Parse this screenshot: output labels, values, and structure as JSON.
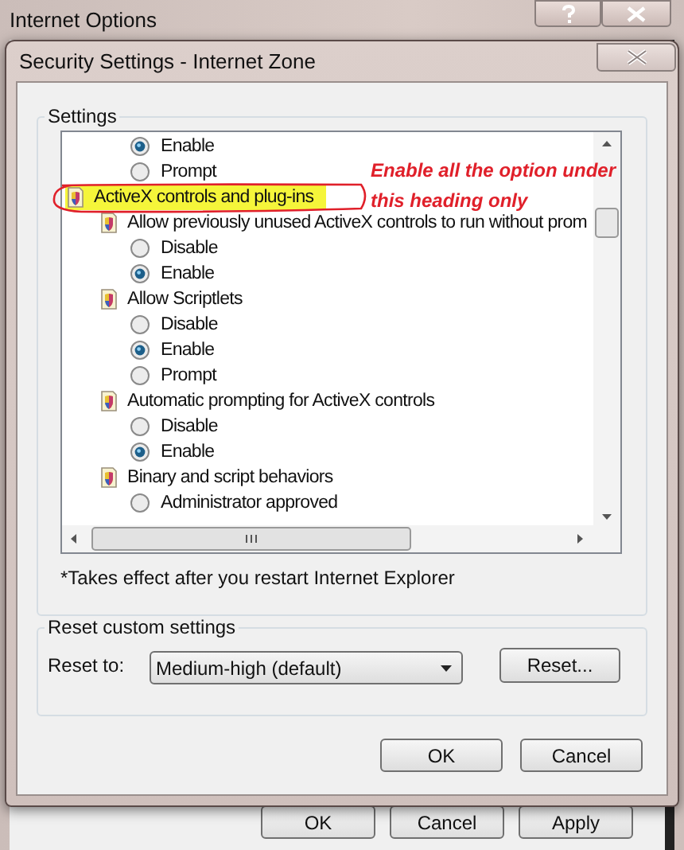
{
  "outer_window": {
    "title": "Internet Options",
    "buttons": [
      "OK",
      "Cancel",
      "Apply"
    ]
  },
  "dialog": {
    "title": "Security Settings - Internet Zone",
    "settings": {
      "label": "Settings",
      "items": [
        {
          "kind": "option",
          "label": "Enable",
          "selected": true
        },
        {
          "kind": "option",
          "label": "Prompt",
          "selected": false
        },
        {
          "kind": "category",
          "label": "ActiveX controls and plug-ins",
          "highlighted": true,
          "children": [
            {
              "kind": "setting",
              "label": "Allow previously unused ActiveX controls to run without prom",
              "children": [
                {
                  "kind": "option",
                  "label": "Disable",
                  "selected": false
                },
                {
                  "kind": "option",
                  "label": "Enable",
                  "selected": true
                }
              ]
            },
            {
              "kind": "setting",
              "label": "Allow Scriptlets",
              "children": [
                {
                  "kind": "option",
                  "label": "Disable",
                  "selected": false
                },
                {
                  "kind": "option",
                  "label": "Enable",
                  "selected": true
                },
                {
                  "kind": "option",
                  "label": "Prompt",
                  "selected": false
                }
              ]
            },
            {
              "kind": "setting",
              "label": "Automatic prompting for ActiveX controls",
              "children": [
                {
                  "kind": "option",
                  "label": "Disable",
                  "selected": false
                },
                {
                  "kind": "option",
                  "label": "Enable",
                  "selected": true
                }
              ]
            },
            {
              "kind": "setting",
              "label": "Binary and script behaviors",
              "children": [
                {
                  "kind": "option",
                  "label": "Administrator approved",
                  "selected": false
                }
              ]
            }
          ]
        }
      ],
      "footnote": "*Takes effect after you restart Internet Explorer"
    },
    "reset": {
      "label": "Reset custom settings",
      "reset_to_label": "Reset to:",
      "dropdown_value": "Medium-high (default)",
      "button": "Reset..."
    },
    "buttons": [
      "OK",
      "Cancel"
    ]
  },
  "annotation": {
    "text": "Enable all the option under this heading only"
  }
}
